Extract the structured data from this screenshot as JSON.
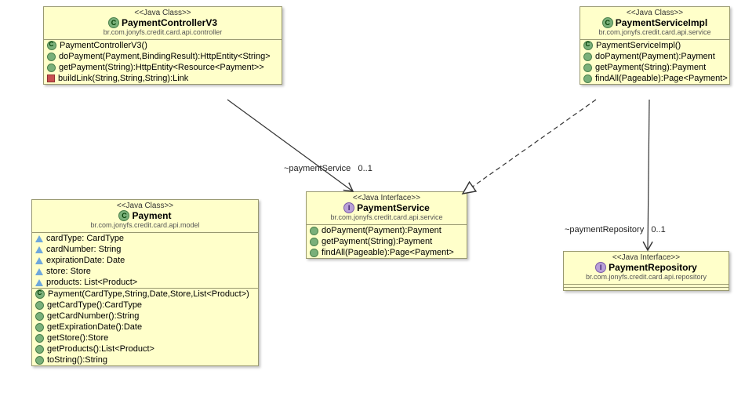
{
  "classes": {
    "controller": {
      "stereotype": "<<Java Class>>",
      "name": "PaymentControllerV3",
      "package": "br.com.jonyfs.credit.card.api.controller",
      "ops": [
        {
          "icon": "constructor",
          "sig": "PaymentControllerV3()"
        },
        {
          "icon": "method",
          "sig": "doPayment(Payment,BindingResult):HttpEntity<String>"
        },
        {
          "icon": "method",
          "sig": "getPayment(String):HttpEntity<Resource<Payment>>"
        },
        {
          "icon": "private",
          "sig": "buildLink(String,String,String):Link"
        }
      ]
    },
    "serviceImpl": {
      "stereotype": "<<Java Class>>",
      "name": "PaymentServiceImpl",
      "package": "br.com.jonyfs.credit.card.api.service",
      "ops": [
        {
          "icon": "constructor",
          "sig": "PaymentServiceImpl()"
        },
        {
          "icon": "method",
          "sig": "doPayment(Payment):Payment"
        },
        {
          "icon": "method",
          "sig": "getPayment(String):Payment"
        },
        {
          "icon": "method",
          "sig": "findAll(Pageable):Page<Payment>"
        }
      ]
    },
    "service": {
      "stereotype": "<<Java Interface>>",
      "name": "PaymentService",
      "package": "br.com.jonyfs.credit.card.api.service",
      "ops": [
        {
          "icon": "method",
          "sig": "doPayment(Payment):Payment"
        },
        {
          "icon": "method",
          "sig": "getPayment(String):Payment"
        },
        {
          "icon": "method",
          "sig": "findAll(Pageable):Page<Payment>"
        }
      ]
    },
    "repository": {
      "stereotype": "<<Java Interface>>",
      "name": "PaymentRepository",
      "package": "br.com.jonyfs.credit.card.api.repository"
    },
    "payment": {
      "stereotype": "<<Java Class>>",
      "name": "Payment",
      "package": "br.com.jonyfs.credit.card.api.model",
      "fields": [
        {
          "sig": "cardType: CardType"
        },
        {
          "sig": "cardNumber: String"
        },
        {
          "sig": "expirationDate: Date"
        },
        {
          "sig": "store: Store"
        },
        {
          "sig": "products: List<Product>"
        }
      ],
      "ops": [
        {
          "icon": "constructor",
          "sig": "Payment(CardType,String,Date,Store,List<Product>)"
        },
        {
          "icon": "method",
          "sig": "getCardType():CardType"
        },
        {
          "icon": "method",
          "sig": "getCardNumber():String"
        },
        {
          "icon": "method",
          "sig": "getExpirationDate():Date"
        },
        {
          "icon": "method",
          "sig": "getStore():Store"
        },
        {
          "icon": "method",
          "sig": "getProducts():List<Product>"
        },
        {
          "icon": "method",
          "sig": "toString():String"
        }
      ]
    }
  },
  "labels": {
    "rel1_role": "~paymentService",
    "rel1_mult": "0..1",
    "rel2_role": "~paymentRepository",
    "rel2_mult": "0..1"
  }
}
